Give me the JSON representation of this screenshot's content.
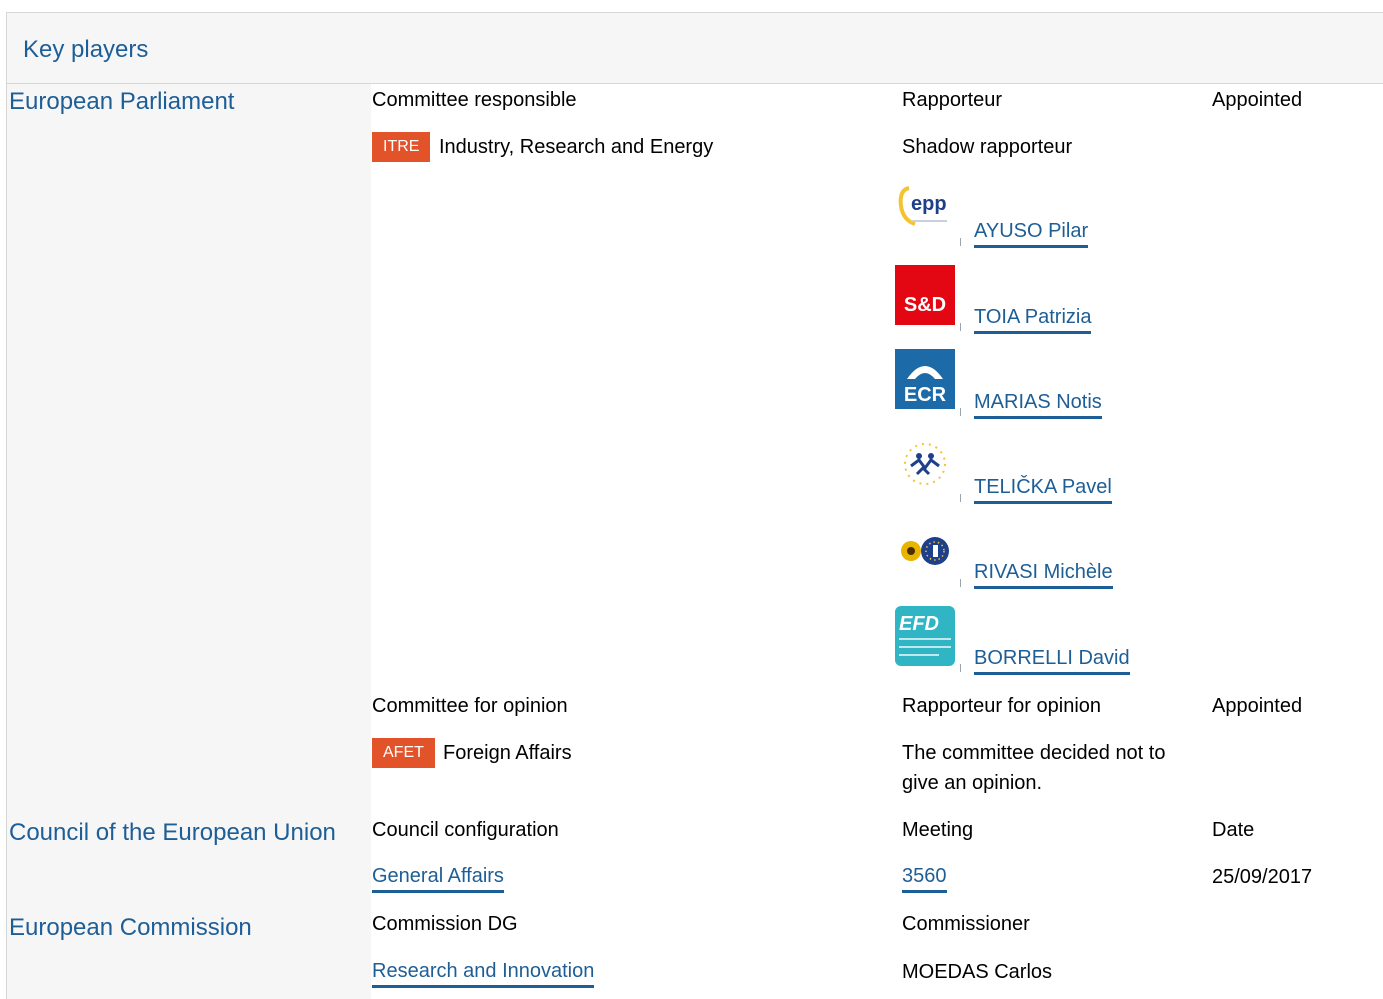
{
  "section_title": "Key players",
  "parliament": {
    "label": "European Parliament",
    "committee_responsible_header": "Committee responsible",
    "rapporteur_header": "Rapporteur",
    "appointed_header": "Appointed",
    "committee": {
      "code": "ITRE",
      "name": "Industry, Research and Energy"
    },
    "shadow_header": "Shadow rapporteur",
    "shadows": [
      {
        "name": "AYUSO Pilar",
        "group_logo": "epp-logo"
      },
      {
        "name": "TOIA Patrizia",
        "group_logo": "sd-logo"
      },
      {
        "name": "MARIAS Notis",
        "group_logo": "ecr-logo"
      },
      {
        "name": "TELIČKA Pavel",
        "group_logo": "alde-logo"
      },
      {
        "name": "RIVASI Michèle",
        "group_logo": "greens-efa-logo"
      },
      {
        "name": "BORRELLI David",
        "group_logo": "efd-logo"
      }
    ],
    "opinion_header": "Committee for opinion",
    "rapporteur_opinion_header": "Rapporteur for opinion",
    "appointed_header_2": "Appointed",
    "opinion_committee": {
      "code": "AFET",
      "name": "Foreign Affairs"
    },
    "opinion_note_line1": "The committee decided not to",
    "opinion_note_line2": "give an opinion."
  },
  "council": {
    "label": "Council of the European Union",
    "config_header": "Council configuration",
    "meeting_header": "Meeting",
    "date_header": "Date",
    "config": "General Affairs",
    "meeting": "3560",
    "date": "25/09/2017"
  },
  "commission": {
    "label": "European Commission",
    "dg_header": "Commission DG",
    "commissioner_header": "Commissioner",
    "dg": "Research and Innovation",
    "commissioner": "MOEDAS Carlos"
  },
  "logo_text": {
    "epp": "epp",
    "sd": "S&D",
    "ecr": "ECR",
    "efd": "EFD"
  },
  "colors": {
    "accent_blue": "#1e5e96",
    "badge_orange": "#e2532a",
    "panel_gray": "#f6f6f6"
  }
}
